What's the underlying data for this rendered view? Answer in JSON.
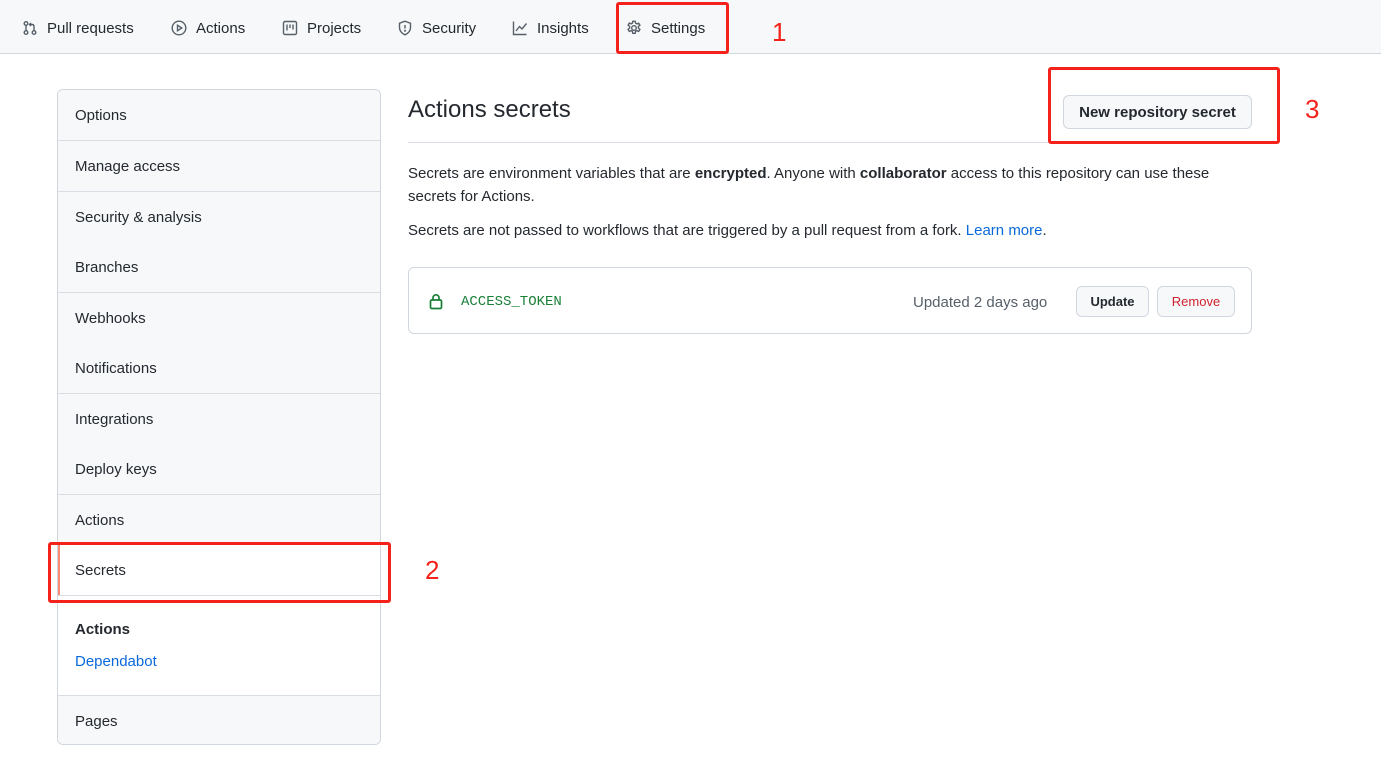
{
  "repo_nav": {
    "items": [
      {
        "label": "Pull requests",
        "icon": "pull-request-icon"
      },
      {
        "label": "Actions",
        "icon": "play-icon"
      },
      {
        "label": "Projects",
        "icon": "project-icon"
      },
      {
        "label": "Security",
        "icon": "shield-icon"
      },
      {
        "label": "Insights",
        "icon": "graph-icon"
      },
      {
        "label": "Settings",
        "icon": "gear-icon"
      }
    ]
  },
  "sidebar": {
    "items": [
      {
        "label": "Options"
      },
      {
        "label": "Manage access"
      },
      {
        "label": "Security & analysis"
      },
      {
        "label": "Branches"
      },
      {
        "label": "Webhooks"
      },
      {
        "label": "Notifications"
      },
      {
        "label": "Integrations"
      },
      {
        "label": "Deploy keys"
      },
      {
        "label": "Actions"
      },
      {
        "label": "Secrets",
        "selected": true
      }
    ],
    "sub_heading": "Actions",
    "sub_link": "Dependabot",
    "pages": "Pages"
  },
  "main": {
    "title": "Actions secrets",
    "new_secret_button": "New repository secret",
    "para1": {
      "p1": "Secrets are environment variables that are ",
      "b1": "encrypted",
      "p2": ". Anyone with ",
      "b2": "collaborator",
      "p3": " access to this repository can use these secrets for Actions."
    },
    "para2": {
      "text": "Secrets are not passed to workflows that are triggered by a pull request from a fork. ",
      "link": "Learn more",
      "end": "."
    },
    "secrets": [
      {
        "name": "ACCESS_TOKEN",
        "updated": "Updated 2 days ago",
        "update_label": "Update",
        "remove_label": "Remove"
      }
    ]
  },
  "annotations": {
    "one": "1",
    "two": "2",
    "three": "3",
    "color": "#f5221b"
  },
  "colors": {
    "accent_link": "#0969da",
    "secret_name": "#1a7f37",
    "danger": "#cf222e",
    "selected_marker": "#fd8c73"
  }
}
